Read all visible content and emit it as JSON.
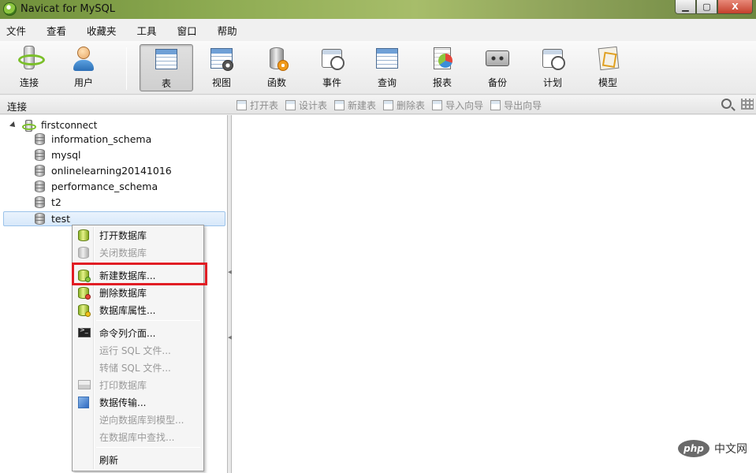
{
  "window": {
    "title": "Navicat for MySQL",
    "min_glyph": "▁",
    "max_glyph": "▢",
    "close_glyph": "X"
  },
  "menu": [
    "文件",
    "查看",
    "收藏夹",
    "工具",
    "窗口",
    "帮助"
  ],
  "toolbar": [
    {
      "label": "连接",
      "icon": "connection-icon"
    },
    {
      "label": "用户",
      "icon": "user-icon"
    },
    {
      "label": "表",
      "icon": "table-icon",
      "active": true
    },
    {
      "label": "视图",
      "icon": "view-icon"
    },
    {
      "label": "函数",
      "icon": "function-icon"
    },
    {
      "label": "事件",
      "icon": "event-icon"
    },
    {
      "label": "查询",
      "icon": "query-icon"
    },
    {
      "label": "报表",
      "icon": "report-icon"
    },
    {
      "label": "备份",
      "icon": "backup-icon"
    },
    {
      "label": "计划",
      "icon": "schedule-icon"
    },
    {
      "label": "模型",
      "icon": "model-icon"
    }
  ],
  "connection_label": "连接",
  "object_tools": [
    "打开表",
    "设计表",
    "新建表",
    "删除表",
    "导入向导",
    "导出向导"
  ],
  "tree": {
    "connection": "firstconnect",
    "databases": [
      "information_schema",
      "mysql",
      "onlinelearning20141016",
      "performance_schema",
      "t2",
      "test"
    ],
    "selected": "test"
  },
  "context_menu": [
    {
      "label": "打开数据库",
      "enabled": true
    },
    {
      "label": "关闭数据库",
      "enabled": false
    },
    {
      "label": "新建数据库...",
      "enabled": true,
      "highlighted": true
    },
    {
      "label": "删除数据库",
      "enabled": true
    },
    {
      "label": "数据库属性...",
      "enabled": true
    },
    {
      "label": "命令列介面...",
      "enabled": true
    },
    {
      "label": "运行 SQL 文件...",
      "enabled": false
    },
    {
      "label": "转储 SQL 文件...",
      "enabled": false
    },
    {
      "label": "打印数据库",
      "enabled": false
    },
    {
      "label": "数据传输...",
      "enabled": true
    },
    {
      "label": "逆向数据库到模型...",
      "enabled": false
    },
    {
      "label": "在数据库中查找...",
      "enabled": false
    },
    {
      "label": "刷新",
      "enabled": true
    }
  ],
  "watermark": {
    "logo": "php",
    "text": "中文网"
  },
  "colors": {
    "highlight": "#e11d24",
    "selection": "#d7e8fa",
    "accent_green": "#8cc63f"
  }
}
